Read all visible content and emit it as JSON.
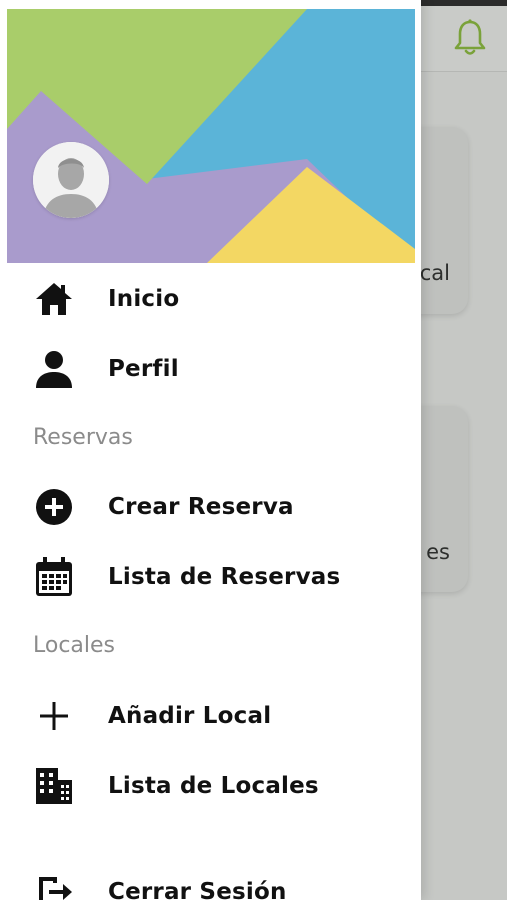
{
  "drawer": {
    "items": [
      {
        "label": "Inicio",
        "icon": "home-icon"
      },
      {
        "label": "Perfil",
        "icon": "person-icon"
      },
      {
        "label": "Crear Reserva",
        "icon": "add-circle-icon"
      },
      {
        "label": "Lista de Reservas",
        "icon": "calendar-icon"
      },
      {
        "label": "Añadir Local",
        "icon": "plus-icon"
      },
      {
        "label": "Lista de Locales",
        "icon": "building-icon"
      },
      {
        "label": "Cerrar Sesión",
        "icon": "logout-icon"
      }
    ],
    "sections": {
      "reservas": "Reservas",
      "locales": "Locales"
    }
  },
  "background": {
    "card1_text": "cal",
    "card2_text": "es",
    "bell_icon": "bell-icon"
  },
  "colors": {
    "header_green": "#a9cd6a",
    "header_blue": "#5bb4d8",
    "header_purple": "#a99bcc",
    "header_yellow": "#f3d763",
    "bell_green": "#7aa23a"
  }
}
